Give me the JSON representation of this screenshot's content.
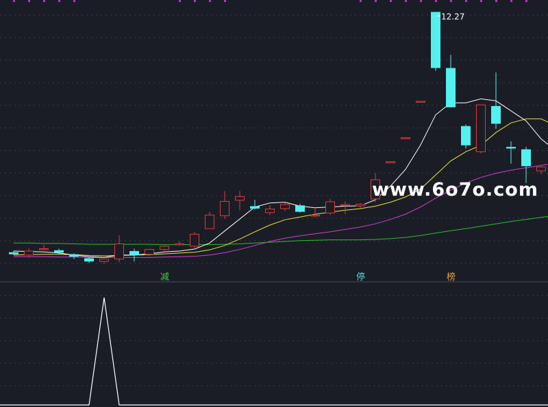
{
  "chart_data": {
    "type": "candlestick",
    "title": "",
    "xlabel": "",
    "ylabel": "",
    "price_range": [
      5.6,
      12.5
    ],
    "peak_label": "12.27",
    "watermark": "www.6o7o.com",
    "markers": [
      {
        "index": 10,
        "text": "减",
        "color": "#3fcf3f"
      },
      {
        "index": 23,
        "text": "停",
        "color": "#4fd8e0"
      },
      {
        "index": 29,
        "text": "榜",
        "color": "#e0a040"
      }
    ],
    "colors": {
      "up": "#e03a3a",
      "down": "#54f0f0",
      "ma_short": "#ffffff",
      "ma_mid": "#e8e83a",
      "ma_long": "#d040d0",
      "ma_longest": "#2bbf2b",
      "indicator": "#ffffff",
      "grid": "#3a3d4a",
      "top_dots": "#c030c0",
      "axis_label": "#ffffff"
    },
    "candles": [
      {
        "o": 6.27,
        "h": 6.3,
        "l": 6.2,
        "c": 6.22
      },
      {
        "o": 6.2,
        "h": 6.36,
        "l": 6.14,
        "c": 6.3
      },
      {
        "o": 6.36,
        "h": 6.46,
        "l": 6.32,
        "c": 6.36
      },
      {
        "o": 6.32,
        "h": 6.36,
        "l": 6.22,
        "c": 6.26
      },
      {
        "o": 6.22,
        "h": 6.24,
        "l": 6.1,
        "c": 6.16
      },
      {
        "o": 6.12,
        "h": 6.14,
        "l": 6.0,
        "c": 6.04
      },
      {
        "o": 6.04,
        "h": 6.1,
        "l": 5.98,
        "c": 6.1
      },
      {
        "o": 6.1,
        "h": 6.7,
        "l": 6.02,
        "c": 6.48
      },
      {
        "o": 6.3,
        "h": 6.36,
        "l": 6.04,
        "c": 6.2
      },
      {
        "o": 6.22,
        "h": 6.34,
        "l": 6.18,
        "c": 6.34
      },
      {
        "o": 6.34,
        "h": 6.44,
        "l": 6.26,
        "c": 6.42
      },
      {
        "o": 6.48,
        "h": 6.55,
        "l": 6.44,
        "c": 6.48
      },
      {
        "o": 6.42,
        "h": 6.78,
        "l": 6.38,
        "c": 6.72
      },
      {
        "o": 6.86,
        "h": 7.28,
        "l": 6.86,
        "c": 7.2
      },
      {
        "o": 7.18,
        "h": 7.8,
        "l": 7.1,
        "c": 7.54
      },
      {
        "o": 7.57,
        "h": 7.8,
        "l": 7.32,
        "c": 7.66
      },
      {
        "o": 7.42,
        "h": 7.58,
        "l": 7.34,
        "c": 7.36
      },
      {
        "o": 7.26,
        "h": 7.44,
        "l": 7.2,
        "c": 7.35
      },
      {
        "o": 7.36,
        "h": 7.52,
        "l": 7.3,
        "c": 7.46
      },
      {
        "o": 7.44,
        "h": 7.48,
        "l": 7.26,
        "c": 7.28
      },
      {
        "o": 7.2,
        "h": 7.38,
        "l": 7.14,
        "c": 7.2
      },
      {
        "o": 7.25,
        "h": 7.6,
        "l": 7.2,
        "c": 7.53
      },
      {
        "o": 7.45,
        "h": 7.54,
        "l": 7.22,
        "c": 7.46
      },
      {
        "o": 7.43,
        "h": 7.5,
        "l": 7.38,
        "c": 7.47
      },
      {
        "o": 7.6,
        "h": 8.24,
        "l": 7.52,
        "c": 8.08
      },
      {
        "o": 8.53,
        "h": 8.53,
        "l": 8.53,
        "c": 8.53
      },
      {
        "o": 9.13,
        "h": 9.13,
        "l": 9.13,
        "c": 9.13
      },
      {
        "o": 10.04,
        "h": 10.04,
        "l": 10.04,
        "c": 10.04
      },
      {
        "o": 12.27,
        "h": 12.27,
        "l": 10.8,
        "c": 10.87
      },
      {
        "o": 10.87,
        "h": 11.2,
        "l": 9.89,
        "c": 9.89
      },
      {
        "o": 9.42,
        "h": 9.46,
        "l": 8.86,
        "c": 8.94
      },
      {
        "o": 8.78,
        "h": 9.95,
        "l": 8.74,
        "c": 9.95
      },
      {
        "o": 9.92,
        "h": 10.76,
        "l": 9.35,
        "c": 9.48
      },
      {
        "o": 8.9,
        "h": 9.04,
        "l": 8.48,
        "c": 8.86
      },
      {
        "o": 8.84,
        "h": 8.9,
        "l": 8.0,
        "c": 8.42
      },
      {
        "o": 8.3,
        "h": 8.42,
        "l": 8.22,
        "c": 8.4
      },
      {
        "o": 8.34,
        "h": 8.58,
        "l": 8.3,
        "c": 8.56
      },
      {
        "o": 8.56,
        "h": 8.68,
        "l": 8.4,
        "c": 8.46
      }
    ],
    "ma_short": [
      6.3,
      6.29,
      6.28,
      6.25,
      6.2,
      6.16,
      6.14,
      6.2,
      6.2,
      6.23,
      6.28,
      6.3,
      6.35,
      6.5,
      6.8,
      7.1,
      7.4,
      7.5,
      7.52,
      7.42,
      7.38,
      7.4,
      7.42,
      7.43,
      7.58,
      7.92,
      8.34,
      8.95,
      9.7,
      10.0,
      10.0,
      10.1,
      10.05,
      9.8,
      9.55,
      9.1,
      8.8,
      8.56
    ],
    "ma_mid": [
      6.2,
      6.21,
      6.22,
      6.22,
      6.21,
      6.19,
      6.18,
      6.19,
      6.2,
      6.21,
      6.23,
      6.25,
      6.27,
      6.33,
      6.44,
      6.6,
      6.78,
      6.95,
      7.08,
      7.15,
      7.22,
      7.27,
      7.32,
      7.36,
      7.42,
      7.52,
      7.65,
      7.85,
      8.2,
      8.55,
      8.78,
      8.94,
      9.26,
      9.5,
      9.6,
      9.6,
      9.42,
      9.05
    ],
    "ma_long": [
      6.16,
      6.16,
      6.16,
      6.15,
      6.15,
      6.14,
      6.14,
      6.14,
      6.14,
      6.14,
      6.15,
      6.16,
      6.17,
      6.2,
      6.26,
      6.34,
      6.44,
      6.54,
      6.62,
      6.68,
      6.73,
      6.78,
      6.84,
      6.9,
      6.98,
      7.09,
      7.22,
      7.4,
      7.62,
      7.82,
      8.0,
      8.14,
      8.24,
      8.32,
      8.38,
      8.44,
      8.5,
      8.56
    ],
    "ma_longest": [
      6.5,
      6.5,
      6.49,
      6.49,
      6.48,
      6.47,
      6.47,
      6.47,
      6.47,
      6.47,
      6.46,
      6.46,
      6.46,
      6.46,
      6.47,
      6.48,
      6.5,
      6.52,
      6.54,
      6.56,
      6.57,
      6.58,
      6.58,
      6.58,
      6.59,
      6.61,
      6.64,
      6.69,
      6.75,
      6.81,
      6.86,
      6.92,
      6.98,
      7.04,
      7.09,
      7.14,
      7.19,
      7.24
    ],
    "indicator": [
      0,
      0,
      0,
      0,
      0,
      0,
      1,
      0,
      0,
      0,
      0,
      0,
      0,
      0,
      0,
      0,
      0,
      0,
      0,
      0,
      0,
      0,
      0,
      0,
      0,
      0,
      0,
      0,
      0,
      0,
      0,
      0,
      0,
      0,
      0,
      0,
      0,
      0
    ]
  }
}
